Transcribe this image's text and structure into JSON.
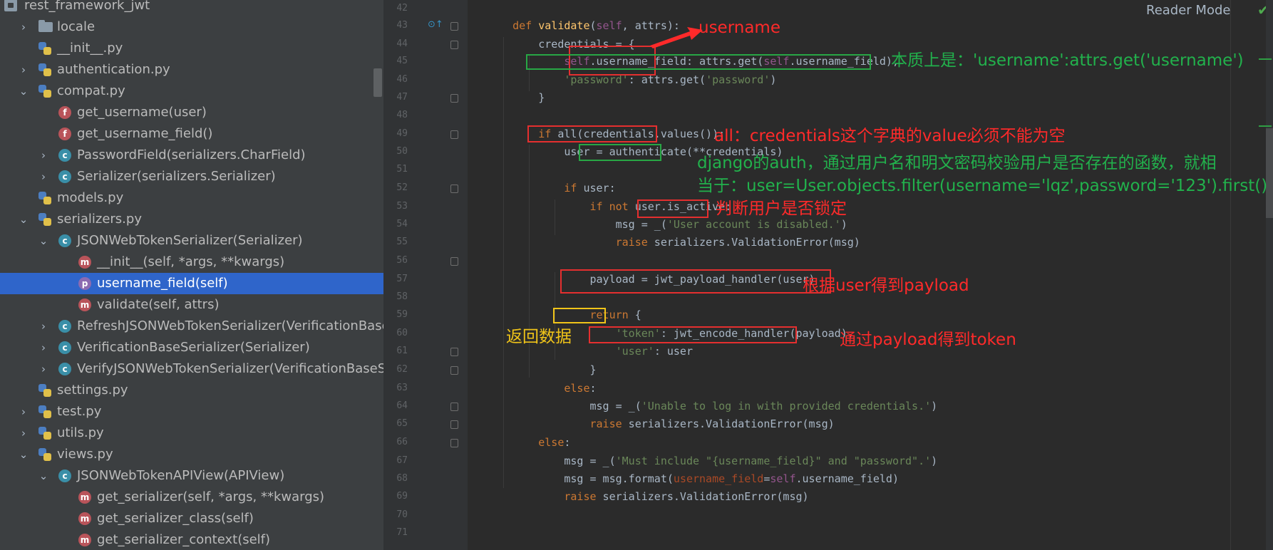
{
  "tree": {
    "rows": [
      {
        "label": "rest_framework_jwt",
        "icon": "package-icon",
        "indent": 0,
        "chev": ""
      },
      {
        "label": "locale",
        "icon": "folder-icon",
        "indent": 1,
        "chev": "right"
      },
      {
        "label": "__init__.py",
        "icon": "python-file-icon",
        "indent": 1,
        "chev": ""
      },
      {
        "label": "authentication.py",
        "icon": "python-file-icon",
        "indent": 1,
        "chev": "right"
      },
      {
        "label": "compat.py",
        "icon": "python-file-icon",
        "indent": 1,
        "chev": "down"
      },
      {
        "label": "get_username(user)",
        "icon": "function-icon",
        "indent": 2,
        "chev": ""
      },
      {
        "label": "get_username_field()",
        "icon": "function-icon",
        "indent": 2,
        "chev": ""
      },
      {
        "label": "PasswordField(serializers.CharField)",
        "icon": "class-icon",
        "indent": 2,
        "chev": "right"
      },
      {
        "label": "Serializer(serializers.Serializer)",
        "icon": "class-icon",
        "indent": 2,
        "chev": "right"
      },
      {
        "label": "models.py",
        "icon": "python-file-icon",
        "indent": 1,
        "chev": ""
      },
      {
        "label": "serializers.py",
        "icon": "python-file-icon",
        "indent": 1,
        "chev": "down"
      },
      {
        "label": "JSONWebTokenSerializer(Serializer)",
        "icon": "class-icon",
        "indent": 2,
        "chev": "down"
      },
      {
        "label": "__init__(self, *args, **kwargs)",
        "icon": "method-icon",
        "indent": 3,
        "chev": ""
      },
      {
        "label": "username_field(self)",
        "icon": "property-icon",
        "indent": 3,
        "chev": "",
        "selected": true
      },
      {
        "label": "validate(self, attrs)",
        "icon": "method-icon",
        "indent": 3,
        "chev": ""
      },
      {
        "label": "RefreshJSONWebTokenSerializer(VerificationBaseSer",
        "icon": "class-icon",
        "indent": 2,
        "chev": "right"
      },
      {
        "label": "VerificationBaseSerializer(Serializer)",
        "icon": "class-icon",
        "indent": 2,
        "chev": "right"
      },
      {
        "label": "VerifyJSONWebTokenSerializer(VerificationBaseSeria",
        "icon": "class-icon",
        "indent": 2,
        "chev": "right"
      },
      {
        "label": "settings.py",
        "icon": "python-file-icon",
        "indent": 1,
        "chev": ""
      },
      {
        "label": "test.py",
        "icon": "python-file-icon",
        "indent": 1,
        "chev": "right"
      },
      {
        "label": "utils.py",
        "icon": "python-file-icon",
        "indent": 1,
        "chev": "right"
      },
      {
        "label": "views.py",
        "icon": "python-file-icon",
        "indent": 1,
        "chev": "down"
      },
      {
        "label": "JSONWebTokenAPIView(APIView)",
        "icon": "class-icon",
        "indent": 2,
        "chev": "down"
      },
      {
        "label": "get_serializer(self, *args, **kwargs)",
        "icon": "method-icon",
        "indent": 3,
        "chev": ""
      },
      {
        "label": "get_serializer_class(self)",
        "icon": "method-icon",
        "indent": 3,
        "chev": ""
      },
      {
        "label": "get_serializer_context(self)",
        "icon": "method-icon",
        "indent": 3,
        "chev": ""
      }
    ]
  },
  "editor": {
    "reader_mode": "Reader Mode",
    "line_numbers": [
      "42",
      "43",
      "44",
      "45",
      "46",
      "47",
      "48",
      "49",
      "50",
      "51",
      "52",
      "53",
      "54",
      "55",
      "56",
      "57",
      "58",
      "59",
      "60",
      "61",
      "62",
      "63",
      "64",
      "65",
      "66",
      "67",
      "68",
      "69",
      "70",
      "71"
    ],
    "code_lines": [
      "",
      "    <span class=\"kw\">def</span> <span class=\"fn\">validate</span>(<span class=\"self\">self</span>, attrs):",
      "        credentials = {",
      "            <span class=\"self\">self</span>.username_field: attrs.get(<span class=\"self\">self</span>.username_field),",
      "            <span class=\"str\">'password'</span>: attrs.get(<span class=\"str\">'password'</span>)",
      "        }",
      "",
      "        <span class=\"kw\">if</span> all(credentials.values()):",
      "            user = authenticate(**credentials)",
      "",
      "            <span class=\"kw\">if</span> user:",
      "                <span class=\"kw\">if not</span> user.is_active:",
      "                    msg = _(<span class=\"str\">'User account is disabled.'</span>)",
      "                    <span class=\"kw\">raise</span> serializers.ValidationError(msg)",
      "",
      "                payload = jwt_payload_handler(user)",
      "",
      "                <span class=\"kw\">return</span> {",
      "                    <span class=\"str\">'token'</span>: jwt_encode_handler(payload),",
      "                    <span class=\"str\">'user'</span>: user",
      "                }",
      "            <span class=\"kw\">else</span>:",
      "                msg = _(<span class=\"str\">'Unable to log in with provided credentials.'</span>)",
      "                <span class=\"kw\">raise</span> serializers.ValidationError(msg)",
      "        <span class=\"kw\">else</span>:",
      "            msg = _(<span class=\"str\">'Must include \"{username_field}\" and \"password\".'</span>)",
      "            msg = msg.format(<span class=\"prm\">username_field</span>=<span class=\"self\">self</span>.username_field)",
      "            <span class=\"kw\">raise</span> serializers.ValidationError(msg)",
      "",
      ""
    ]
  },
  "annotations": {
    "username": "username",
    "essence": "本质上是：'username':attrs.get('username')",
    "all_note": "all：credentials这个字典的value必须不能为空",
    "django_auth_1": "django的auth，通过用户名和明文密码校验用户是否存在的函数，就相",
    "django_auth_2": "当于：user=User.objects.filter(username='lqz',password='123').first()",
    "is_active_note": "判断用户是否锁定",
    "payload_note": "根据user得到payload",
    "return_note": "返回数据",
    "token_note": "通过payload得到token"
  },
  "colors": {
    "red": "#ff2a2a",
    "green": "#22b14c",
    "yellow": "#f0c419",
    "selection": "#2f65ca"
  }
}
